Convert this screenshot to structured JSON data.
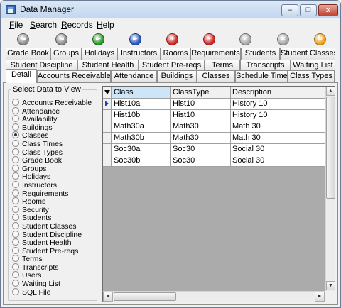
{
  "window": {
    "title": "Data Manager",
    "min_glyph": "–",
    "max_glyph": "□",
    "close_glyph": "x"
  },
  "menu": [
    {
      "key": "F",
      "rest": "ile"
    },
    {
      "key": "S",
      "rest": "earch"
    },
    {
      "key": "R",
      "rest": "ecords"
    },
    {
      "key": "H",
      "rest": "elp"
    }
  ],
  "toolbar": [
    {
      "icon": "first-record-icon",
      "color": "#8f8f8f",
      "glyph": "◄"
    },
    {
      "icon": "previous-record-icon",
      "color": "#8f8f8f",
      "glyph": "◄"
    },
    {
      "icon": "next-record-icon",
      "color": "#2e9b2e",
      "glyph": "►"
    },
    {
      "icon": "last-record-icon",
      "color": "#2a5bc7",
      "glyph": "►"
    },
    {
      "icon": "add-record-icon",
      "color": "#d42a2a",
      "glyph": "+"
    },
    {
      "icon": "delete-record-icon",
      "color": "#d42a2a",
      "glyph": "–"
    },
    {
      "icon": "save-record-icon",
      "color": "#a9a9a9",
      "glyph": "✓"
    },
    {
      "icon": "cancel-edit-icon",
      "color": "#a9a9a9",
      "glyph": "×"
    },
    {
      "icon": "refresh-icon",
      "color": "#f0a020",
      "glyph": "↻"
    }
  ],
  "tabs": {
    "row1": [
      "Grade Book",
      "Groups",
      "Holidays",
      "Instructors",
      "Rooms",
      "Requirements",
      "Students",
      "Student Classes"
    ],
    "row2": [
      "Student Discipline",
      "Student Health",
      "Student Pre-reqs",
      "Terms",
      "Transcripts",
      "Waiting List"
    ],
    "row3": [
      "Detail",
      "Accounts Receivable",
      "Attendance",
      "Buildings",
      "Classes",
      "Schedule Times",
      "Class Types"
    ],
    "active": "Detail"
  },
  "panel": {
    "title": "Select Data to View",
    "selected": "Classes",
    "options": [
      "Accounts Receivable",
      "Attendance",
      "Availability",
      "Buildings",
      "Classes",
      "Class Times",
      "Class Types",
      "Grade Book",
      "Groups",
      "Holidays",
      "Instructors",
      "Requirements",
      "Rooms",
      "Security",
      "Students",
      "Student Classes",
      "Student Discipline",
      "Student Health",
      "Student Pre-reqs",
      "Terms",
      "Transcripts",
      "Users",
      "Waiting List",
      "SQL File"
    ]
  },
  "grid": {
    "columns": [
      "Class",
      "ClassType",
      "Description"
    ],
    "rows": [
      [
        "Hist10a",
        "Hist10",
        "History 10"
      ],
      [
        "Hist10b",
        "Hist10",
        "History 10"
      ],
      [
        "Math30a",
        "Math30",
        "Math 30"
      ],
      [
        "Math30b",
        "Math30",
        "Math 30"
      ],
      [
        "Soc30a",
        "Soc30",
        "Social 30"
      ],
      [
        "Soc30b",
        "Soc30",
        "Social 30"
      ]
    ],
    "current_row": 0
  }
}
